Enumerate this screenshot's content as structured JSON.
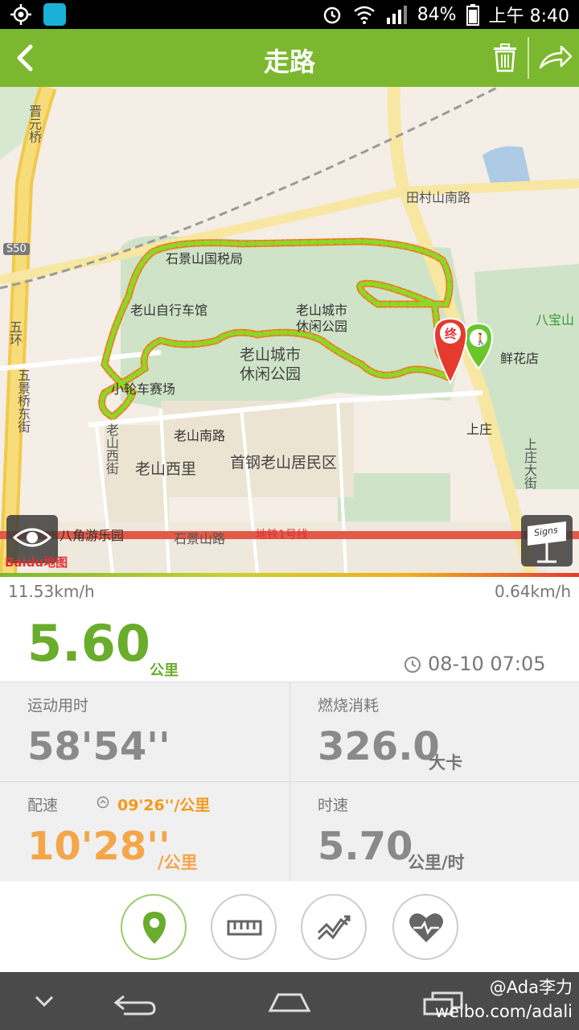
{
  "status_bar": {
    "battery": "84%",
    "time": "上午 8:40"
  },
  "header": {
    "title": "走路"
  },
  "map": {
    "labels": {
      "jinyuan_bridge": "晋元桥",
      "s50": "S50",
      "wuhuan": "五环",
      "wujingqiao": "五景桥东街",
      "tiancun": "田村山南路",
      "shijingshan_tax": "石景山国税局",
      "bike_hall": "老山自行车馆",
      "park_poi_1": "老山城市",
      "park_poi_2": "休闲公园",
      "park_big_1": "老山城市",
      "park_big_2": "休闲公园",
      "bmx": "小轮车赛场",
      "laoshan_south": "老山南路",
      "laoshan_west": "老山西街",
      "laoshan_xili": "老山西里",
      "shougang": "首钢老山居民区",
      "babao": "八宝山",
      "flower": "鲜花店",
      "shangzhuang": "上庄",
      "shangzhuang_st": "上庄大街",
      "bajiao": "八角游乐园",
      "shijingshan_rd": "石景山路",
      "subway": "地铁1号线",
      "baidu": "Baidu地图",
      "end_marker": "终",
      "sign_text": "Signs"
    }
  },
  "speed": {
    "max": "11.53km/h",
    "min": "0.64km/h"
  },
  "summary": {
    "distance": "5.60",
    "distance_unit": "公里",
    "datetime": "08-10 07:05"
  },
  "stats": {
    "duration_label": "运动用时",
    "duration_value": "58'54''",
    "calories_label": "燃烧消耗",
    "calories_value": "326.0",
    "calories_unit": "大卡",
    "pace_label": "配速",
    "best_pace": "09'26''/公里",
    "pace_value": "10'28''",
    "pace_unit": "/公里",
    "speed_label": "时速",
    "speed_value": "5.70",
    "speed_unit": "公里/时"
  },
  "tabs": [
    "map-pin-icon",
    "ruler-icon",
    "trend-chart-icon",
    "heart-rate-icon"
  ],
  "watermark": {
    "line1": "@Ada李力",
    "line2": "weibo.com/adali"
  },
  "colors": {
    "brand_green": "#7cb82f",
    "accent_orange": "#f4a64a",
    "marker_red": "#e53b2f"
  }
}
